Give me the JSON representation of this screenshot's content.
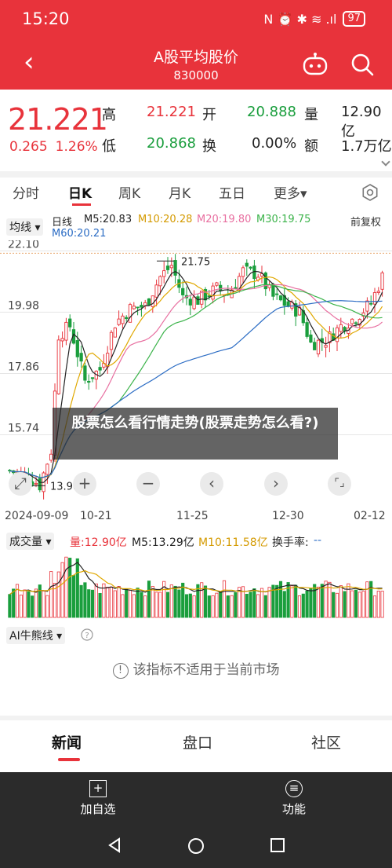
{
  "status_bar": {
    "time": "15:20",
    "icons": "N ⏰ ✱ ≋ .ıl",
    "battery": "97"
  },
  "header": {
    "title": "A股平均股价",
    "code": "830000"
  },
  "quote": {
    "price": "21.221",
    "change": "0.265",
    "change_pct": "1.26%",
    "high_label": "高",
    "high": "21.221",
    "open_label": "开",
    "open": "20.888",
    "volume_label": "量",
    "volume": "12.90亿",
    "low_label": "低",
    "low": "20.868",
    "turnover_label": "换",
    "turnover": "0.00%",
    "amount_label": "额",
    "amount": "1.7万亿"
  },
  "period_tabs": [
    "分时",
    "日K",
    "周K",
    "月K",
    "五日",
    "更多▾"
  ],
  "active_period_tab": "日K",
  "chart": {
    "ma_selector": "均线",
    "series_label": "日线",
    "ma5": "M5:20.83",
    "ma10": "M10:20.28",
    "ma20": "M20:19.80",
    "ma30": "M30:19.75",
    "ma60": "M60:20.21",
    "adjust": "前复权",
    "high_marker": "21.75",
    "low_marker": "13.98",
    "x_labels": [
      "2024-09-09",
      "10-21",
      "11-25",
      "12-30",
      "02-12"
    ],
    "colors": {
      "up": "#e8333b",
      "down": "#1a9e3d",
      "ma5": "#222222",
      "ma10": "#e0a800",
      "ma20": "#e86fa0",
      "ma30": "#3bb34a",
      "ma60": "#2b6cc4"
    }
  },
  "chart_data": {
    "type": "candlestick",
    "x_range": [
      "2024-09-09",
      "02-12"
    ],
    "ylim": [
      13.5,
      22.3
    ],
    "y_ticks": [
      22.1,
      19.98,
      17.86,
      15.74
    ],
    "annotations": {
      "high": 21.75,
      "low": 13.98
    },
    "volume_panel": {
      "selector": "成交量",
      "vol": "量:12.90亿",
      "m5": "M5:13.29亿",
      "m10": "M10:11.58亿",
      "turnover_label": "换手率:",
      "turnover": "--"
    }
  },
  "overlay_text": "股票怎么看行情走势(股票走势怎么看?)",
  "ai_indicator": {
    "selector": "AI牛熊线",
    "notice": "该指标不适用于当前市场"
  },
  "bottom_tabs": [
    "新闻",
    "盘口",
    "社区"
  ],
  "actions": {
    "add": "加自选",
    "function": "功能"
  }
}
